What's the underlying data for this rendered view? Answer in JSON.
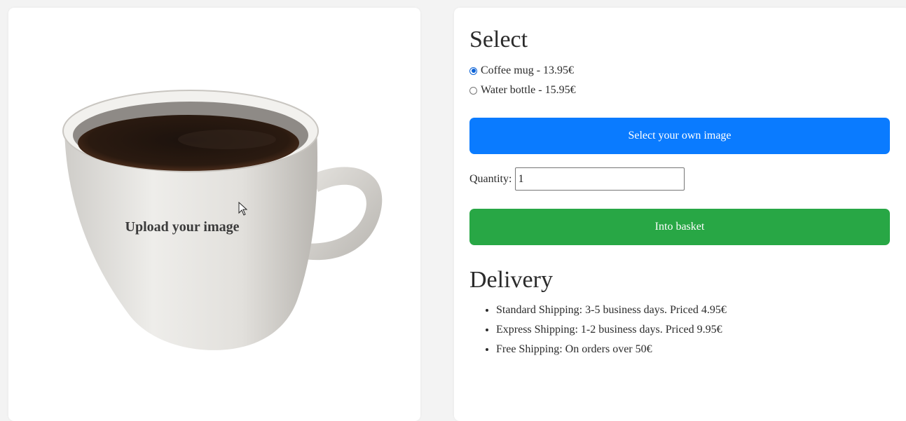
{
  "preview": {
    "upload_label": "Upload your image",
    "mug_icon": "coffee-mug-image",
    "cursor_icon": "mouse-pointer-icon"
  },
  "select": {
    "heading": "Select",
    "options": [
      {
        "label": "Coffee mug - 13.95€",
        "checked": true
      },
      {
        "label": "Water bottle - 15.95€",
        "checked": false
      }
    ],
    "own_image_button": "Select your own image",
    "quantity_label": "Quantity:",
    "quantity_value": "1",
    "basket_button": "Into basket"
  },
  "delivery": {
    "heading": "Delivery",
    "items": [
      "Standard Shipping: 3-5 business days. Priced 4.95€",
      "Express Shipping: 1-2 business days. Priced 9.95€",
      "Free Shipping: On orders over 50€"
    ]
  },
  "colors": {
    "primary_button": "#0a7bff",
    "success_button": "#28a745",
    "page_bg": "#f3f3f3"
  }
}
